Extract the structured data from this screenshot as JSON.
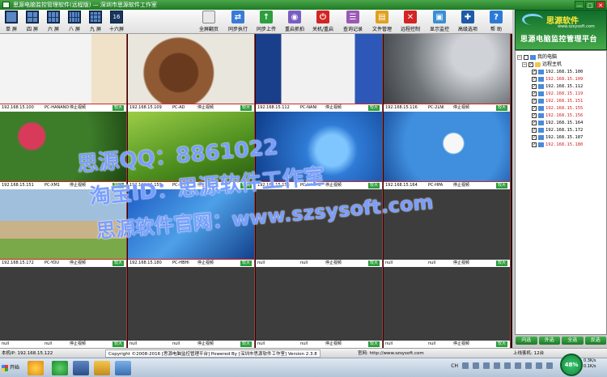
{
  "window": {
    "title": "思源电脑监控管理软件(远程版) — 深圳市思源软件工作室",
    "controls": [
      "—",
      "□",
      "✕"
    ]
  },
  "toolbar": {
    "layouts": [
      {
        "label": "单 屏",
        "cols": 1,
        "rows": 1
      },
      {
        "label": "四 屏",
        "cols": 2,
        "rows": 2
      },
      {
        "label": "六 屏",
        "cols": 3,
        "rows": 2
      },
      {
        "label": "八 屏",
        "cols": 4,
        "rows": 2
      },
      {
        "label": "九 屏",
        "cols": 3,
        "rows": 3
      },
      {
        "label": "十六屏",
        "cols": 4,
        "rows": 4,
        "text": "16"
      }
    ],
    "tools": [
      {
        "label": "全屏翻页",
        "icon": "fullscreen-page-icon",
        "color": "#e8e8e8",
        "glyph": ""
      },
      {
        "label": "同步执行",
        "icon": "sync-exec-icon",
        "color": "#3a7bd5",
        "glyph": "⇄"
      },
      {
        "label": "同步上传",
        "icon": "sync-upload-icon",
        "color": "#2e9e3e",
        "glyph": "↑"
      },
      {
        "label": "重启抓拍",
        "icon": "restart-capture-icon",
        "color": "#7a5cc2",
        "glyph": "◉"
      },
      {
        "label": "关机/重启",
        "icon": "power-icon",
        "color": "#d42424",
        "glyph": "⏻"
      },
      {
        "label": "查询记录",
        "icon": "query-log-icon",
        "color": "#9b59b6",
        "glyph": "☰"
      },
      {
        "label": "文件管理",
        "icon": "file-manage-icon",
        "color": "#e0a020",
        "glyph": "▤"
      },
      {
        "label": "远程控制",
        "icon": "remote-control-icon",
        "color": "#d42424",
        "glyph": "✕"
      },
      {
        "label": "显示监控",
        "icon": "display-monitor-icon",
        "color": "#3a8fd5",
        "glyph": "▣"
      },
      {
        "label": "高级选项",
        "icon": "advanced-options-icon",
        "color": "#1d5aa8",
        "glyph": "✚"
      },
      {
        "label": "帮 助",
        "icon": "help-icon",
        "color": "#2c7ad8",
        "glyph": "?"
      }
    ]
  },
  "logo": {
    "brand": "思源软件",
    "url": "www.szsysoft.com",
    "subtitle": "思源电脑监控管理平台"
  },
  "cells": [
    {
      "ip": "192.168.15.100",
      "pc": "PC-HANAND",
      "stop": "停止视频",
      "big": "较大",
      "screen": "desktop-white"
    },
    {
      "ip": "192.168.15.109",
      "pc": "PC-AD",
      "stop": "停止视频",
      "big": "较大",
      "screen": "photo-chestnut"
    },
    {
      "ip": "192.168.15.112",
      "pc": "PC-NANI",
      "stop": "停止视频",
      "big": "较大",
      "screen": "desktop-blue"
    },
    {
      "ip": "192.168.15.116",
      "pc": "PC-2LNI",
      "stop": "停止视频",
      "big": "较大",
      "screen": "photo-girl"
    },
    {
      "ip": "192.168.15.151",
      "pc": "PC-XM1",
      "stop": "停止视频",
      "big": "较大",
      "screen": "photo-garden"
    },
    {
      "ip": "192.168.15.155",
      "pc": "PC-HNJE",
      "stop": "停止视频",
      "big": "较大",
      "screen": "photo-green"
    },
    {
      "ip": "192.168.15.156",
      "pc": "PC-NACHL",
      "stop": "停止视频",
      "big": "较大",
      "screen": "desktop-win7"
    },
    {
      "ip": "192.168.15.164",
      "pc": "PC-HPA",
      "stop": "停止视频",
      "big": "较大",
      "screen": "desktop-dialog"
    },
    {
      "ip": "192.168.15.172",
      "pc": "PC-YOU",
      "stop": "停止视频",
      "big": "较大",
      "screen": "photo-dogs"
    },
    {
      "ip": "192.168.15.180",
      "pc": "PC-HBHI",
      "stop": "停止视频",
      "big": "较大",
      "screen": "desktop-blue2"
    },
    {
      "ip": "null",
      "pc": "null",
      "stop": "停止视频",
      "big": "较大",
      "screen": "empty"
    },
    {
      "ip": "null",
      "pc": "null",
      "stop": "停止视频",
      "big": "较大",
      "screen": "empty"
    },
    {
      "ip": "null",
      "pc": "null",
      "stop": "停止视频",
      "big": "较大",
      "screen": "empty"
    },
    {
      "ip": "null",
      "pc": "null",
      "stop": "停止视频",
      "big": "较大",
      "screen": "empty"
    },
    {
      "ip": "null",
      "pc": "null",
      "stop": "停止视频",
      "big": "较大",
      "screen": "empty"
    },
    {
      "ip": "null",
      "pc": "null",
      "stop": "停止视频",
      "big": "较大",
      "screen": "empty"
    }
  ],
  "tree": {
    "root": "我的电脑",
    "group": "远程主机",
    "hosts": [
      {
        "ip": "192.168.15.100",
        "red": false
      },
      {
        "ip": "192.168.15.109",
        "red": true
      },
      {
        "ip": "192.168.15.112",
        "red": false
      },
      {
        "ip": "192.168.15.119",
        "red": true
      },
      {
        "ip": "192.168.15.151",
        "red": true
      },
      {
        "ip": "192.168.15.155",
        "red": true
      },
      {
        "ip": "192.168.15.156",
        "red": true
      },
      {
        "ip": "192.168.15.164",
        "red": false
      },
      {
        "ip": "192.168.15.172",
        "red": false
      },
      {
        "ip": "192.168.15.187",
        "red": false
      },
      {
        "ip": "192.168.15.180",
        "red": true
      }
    ]
  },
  "right_buttons": [
    "内选",
    "外选",
    "全选",
    "反选"
  ],
  "status": {
    "local_ip": "本机IP: 192.168.15.122",
    "copyright": "Copyright ©2008-2016 [思源电脑监控管理平台] Powered By [深圳市思源软件工作室] Version 2.3.8",
    "website": "官网: http://www.szsysoft.com",
    "online": "上线客机: 12台"
  },
  "taskbar": {
    "start": "开始",
    "cpu": "48%",
    "cpu_stat1": "0.3K/s",
    "cpu_stat2": "0.1K/s",
    "tray_text": "CH"
  },
  "watermark": {
    "line1": "思源QQ：8861022",
    "line2": "淘宝ID：思源软件工作室",
    "line3": "思源软件官网：www.szsysoft.com"
  }
}
